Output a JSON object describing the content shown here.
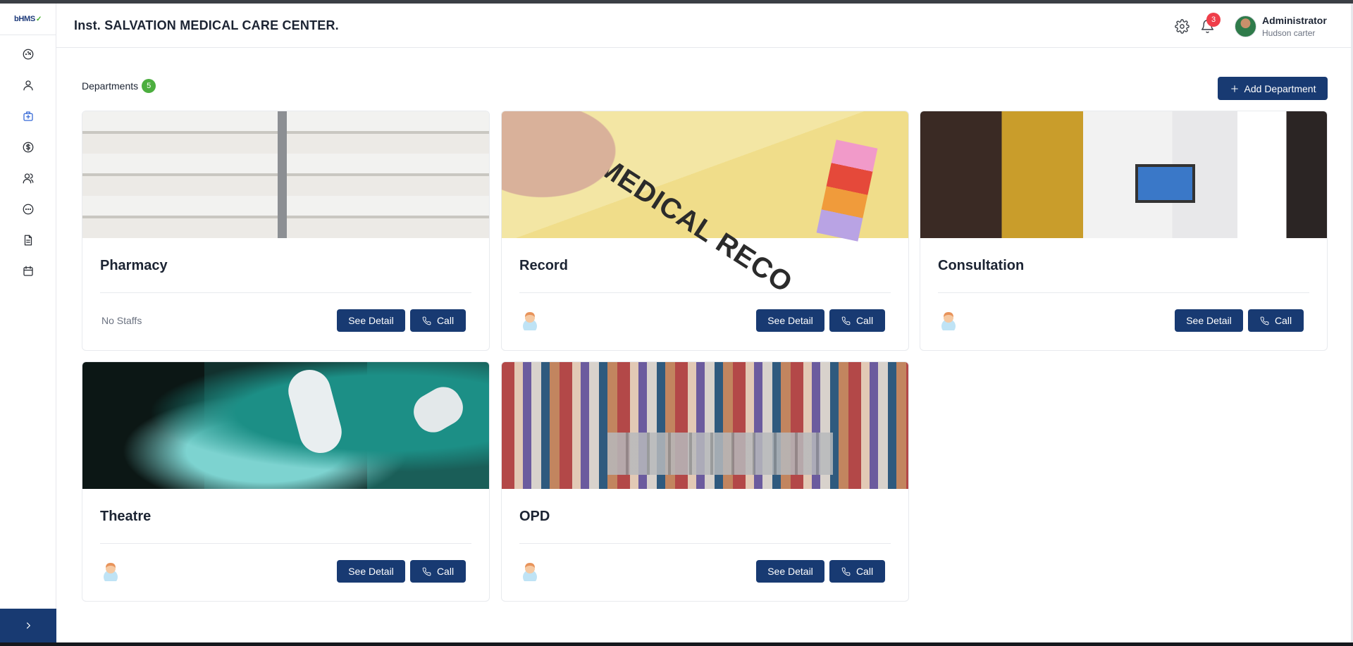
{
  "app": {
    "logo_text": "bHMS",
    "logo_mark": "✓",
    "org_name": "Inst. SALVATION MEDICAL CARE CENTER."
  },
  "sidebar": {
    "items": [
      {
        "icon": "dashboard-icon"
      },
      {
        "icon": "user-icon"
      },
      {
        "icon": "hospital-icon",
        "active": true
      },
      {
        "icon": "dollar-icon"
      },
      {
        "icon": "users-icon"
      },
      {
        "icon": "chat-icon"
      },
      {
        "icon": "document-icon"
      },
      {
        "icon": "calendar-icon"
      }
    ],
    "expand_icon": "chevron-right-icon"
  },
  "header": {
    "notification_count": "3",
    "user_name": "Administrator",
    "user_subtitle": "Hudson carter"
  },
  "departments": {
    "title": "Departments",
    "count": "5",
    "add_button_label": "Add Department",
    "detail_label": "See Detail",
    "call_label": "Call",
    "no_staff_label": "No Staffs",
    "items": [
      {
        "name": "Pharmacy",
        "has_staff": false
      },
      {
        "name": "Record",
        "has_staff": true
      },
      {
        "name": "Consultation",
        "has_staff": true
      },
      {
        "name": "Theatre",
        "has_staff": true
      },
      {
        "name": "OPD",
        "has_staff": true
      }
    ],
    "record_image_text": "MEDICAL RECO"
  },
  "colors": {
    "primary": "#183a72",
    "success": "#4cae3f",
    "danger": "#ef3e4a",
    "active_icon": "#3468d6"
  }
}
